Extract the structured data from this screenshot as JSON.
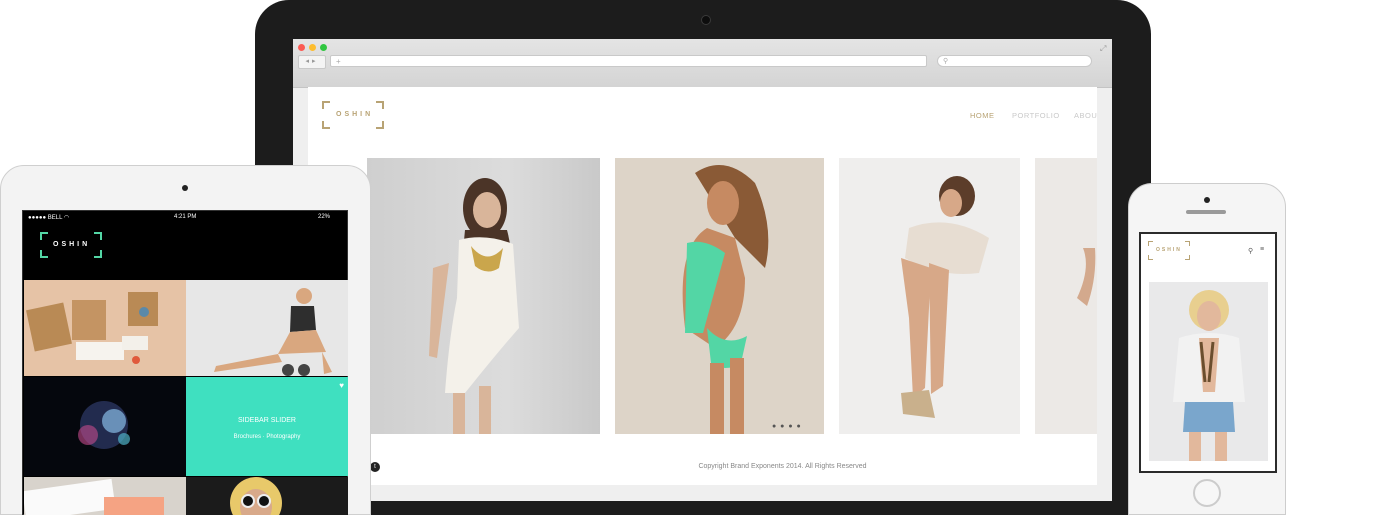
{
  "desktop": {
    "url_placeholder": "",
    "logo_text": "OSHIN",
    "nav": [
      {
        "label": "HOME",
        "active": true
      },
      {
        "label": "PORTFOLIO",
        "active": false
      },
      {
        "label": "ABOUT",
        "active": false
      }
    ],
    "slider_dots": "● ● ● ●",
    "copyright": "Copyright Brand Exponents 2014. All Rights Reserved",
    "social_icon": "twitter-icon"
  },
  "tablet": {
    "status": {
      "carrier": "●●●●● BELL ◠",
      "time": "4:21 PM",
      "battery": "22%"
    },
    "logo_text": "OSHIN",
    "tile_title": "SIDEBAR SLIDER",
    "tile_subtitle": "Brochures · Photography"
  },
  "phone": {
    "logo_text": "OSHIN"
  },
  "colors": {
    "accent_gold": "#b8a374",
    "accent_green": "#53d6a5",
    "tile_mint": "#3fe0c0"
  }
}
